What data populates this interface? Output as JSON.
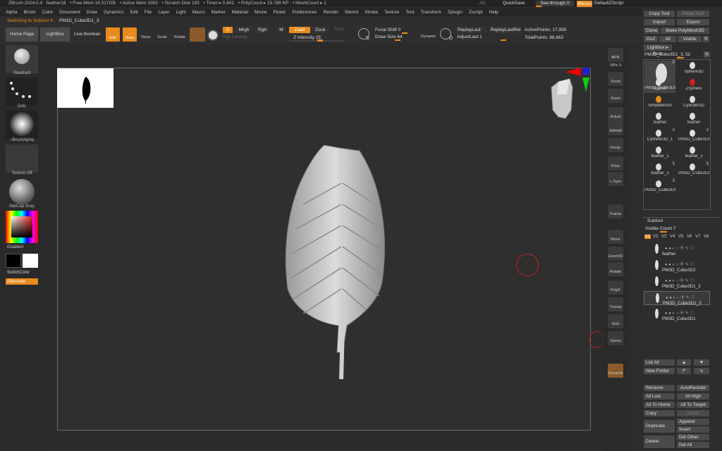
{
  "titlebar": {
    "app": "ZBrush 2024.0.4",
    "doc": "feather18",
    "free_mem": "• Free Mem 16.517GB",
    "active_mem": "• Active Mem 1063",
    "scratch": "• Scratch Disk 193",
    "timer": "• Timer ▸ 0.841",
    "polycount": "• PolyCount ▸ 19.789 KP",
    "meshcount": "• MeshCount ▸ 1",
    "ac": "AC",
    "quicksave": "QuickSave",
    "see_through": "See-through 0",
    "menus": "Menus",
    "script": "DefaultZScript"
  },
  "menubar": [
    "Alpha",
    "Brush",
    "Color",
    "Document",
    "Draw",
    "Dynamics",
    "Edit",
    "File",
    "Layer",
    "Light",
    "Macro",
    "Marker",
    "Material",
    "Movie",
    "Picker",
    "Preferences",
    "Render",
    "Stencil",
    "Stroke",
    "Texture",
    "Tool",
    "Transform",
    "Zplugin",
    "Zscript",
    "Help"
  ],
  "status": {
    "switching": "Switching to Subtool 4:",
    "subtool_name": "PM3D_Cube3D1_3"
  },
  "toolbar": {
    "home": "Home Page",
    "lightbox": "LightBox",
    "live_boolean": "Live Boolean",
    "edit": "Edit",
    "draw": "Draw",
    "move": "Move",
    "scale": "Scale",
    "rotate": "Rotate",
    "a": "A",
    "mrgb": "Mrgb",
    "rgb": "Rgb",
    "m": "M",
    "zadd": "Zadd",
    "zsub": "Zsub",
    "zcut": "Zcut",
    "rgb_intensity": "Rgb Intensity",
    "z_intensity": "Z Intensity 25",
    "focal_shift": "Focal Shift 0",
    "draw_size": "Draw Size 64",
    "dynamic": "Dynamic",
    "replay_last": "ReplayLast",
    "replay_last_rel": "ReplayLastRel",
    "adjust_last": "AdjustLast 1",
    "active_points": "ActivePoints: 17,995",
    "total_points": "TotalPoints: 88,662",
    "s": "S",
    "d": "D"
  },
  "left": {
    "standard": "Standard",
    "dots": "Dots",
    "brush_alpha": "~BrushAlpha",
    "texture_off": "Texture Off",
    "matcap": "MatCap Gray",
    "gradient": "Gradient",
    "switch_color": "SwitchColor",
    "alternate": "Alternate"
  },
  "shelf": [
    "BPR",
    "SPix 3",
    "Scroll",
    "Zoom",
    "Actual",
    "AAHalf",
    "Persp",
    "Floor",
    "L.Sym",
    "Frame",
    "Move",
    "Zoom3D",
    "Rotate",
    "PolyF",
    "Transp",
    "Solo",
    "Xpose",
    "Dynamic"
  ],
  "tool_panel": {
    "copy_tool": "Copy Tool",
    "paste_tool": "Paste Tool",
    "import": "Import",
    "export": "Export",
    "clone": "Clone",
    "make_polymesh": "Make PolyMesh3D",
    "goz": "GoZ",
    "all": "All",
    "visible": "Visible",
    "r": "R",
    "lightbox_tools": "Lightbox ▸ Tools",
    "current": "PM3D_Cube3D1_3. 52",
    "tools": [
      {
        "name": "PM3D_Cube3D1",
        "badge": "5"
      },
      {
        "name": "Sphere3D",
        "badge": ""
      },
      {
        "name": "feather",
        "badge": ""
      },
      {
        "name": "ZSphere",
        "badge": ""
      },
      {
        "name": "SimpleBrush",
        "badge": ""
      },
      {
        "name": "Cylinder3D",
        "badge": ""
      },
      {
        "name": "feather",
        "badge": ""
      },
      {
        "name": "feather",
        "badge": ""
      },
      {
        "name": "Cylinder3D_1",
        "badge": "2"
      },
      {
        "name": "PM3D_Cube3D1",
        "badge": "2"
      },
      {
        "name": "feather_1",
        "badge": ""
      },
      {
        "name": "feather_2",
        "badge": ""
      },
      {
        "name": "feather_3",
        "badge": "5"
      },
      {
        "name": "PM3D_Cube3D1",
        "badge": "5"
      },
      {
        "name": "PM3D_Cube3D1",
        "badge": "3"
      }
    ]
  },
  "subtool": {
    "title": "Subtool",
    "visible_count": "Visible Count 7",
    "versions": [
      "V1",
      "V2",
      "V3",
      "V4",
      "V5",
      "V6",
      "V7",
      "V8"
    ],
    "items": [
      "feather",
      "PM3D_Cube3D2",
      "PM3D_Cube3D1_2",
      "PM3D_Cube3D1_3",
      "PM3D_Cube3D1"
    ],
    "buttons": {
      "list_all": "List All",
      "new_folder": "New Folder",
      "rename": "Rename",
      "auto_reorder": "AutoReorder",
      "all_low": "All Low",
      "all_high": "All High",
      "all_to_home": "All To Home",
      "all_to_target": "All To Target",
      "copy": "Copy",
      "paste": "Paste",
      "duplicate": "Duplicate",
      "append": "Append",
      "insert": "Insert",
      "delete": "Delete",
      "del_other": "Del Other",
      "del_all": "Del All"
    }
  },
  "colors": {
    "accent": "#e98a1c",
    "bg": "#2c2c2c"
  }
}
